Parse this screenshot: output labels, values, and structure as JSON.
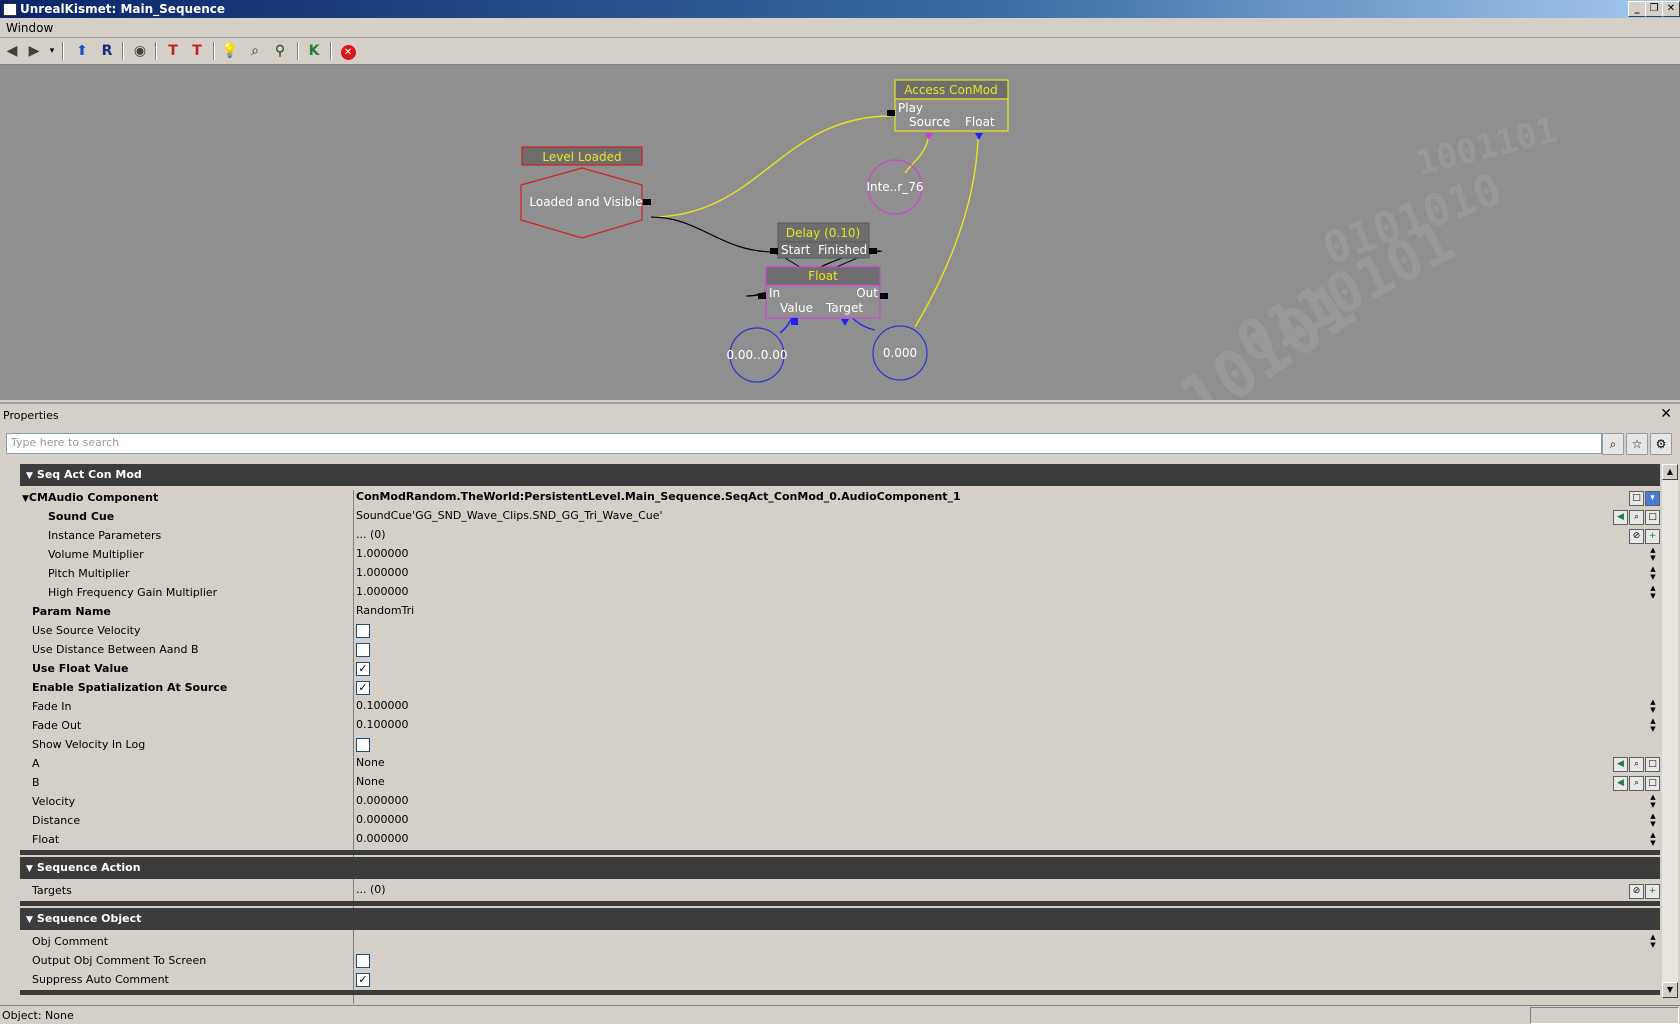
{
  "window": {
    "title": "UnrealKismet: Main_Sequence",
    "min": "_",
    "max": "❐",
    "close": "✕"
  },
  "menu": {
    "window": "Window"
  },
  "toolbar": {
    "icons": [
      "back-arrow-icon",
      "forward-arrow-icon",
      "history-dropdown-icon",
      "parent-sequence-icon",
      "refresh-icon",
      "hide-connectors-icon",
      "toggle-links-icon",
      "toggle-links-alt-icon",
      "bulb-icon",
      "search-icon",
      "binoculars-icon",
      "kismet-k-icon",
      "stop-icon"
    ]
  },
  "graph": {
    "nodes": {
      "level_loaded": {
        "title": "Level Loaded",
        "body": "Loaded and Visible"
      },
      "access_conmod": {
        "title": "Access ConMod",
        "play": "Play",
        "source": "Source",
        "float": "Float"
      },
      "delay": {
        "title": "Delay (0.10)",
        "start": "Start",
        "finished": "Finished"
      },
      "float": {
        "title": "Float",
        "in": "In",
        "out": "Out",
        "value": "Value",
        "target": "Target"
      },
      "var_inte": {
        "label": "Inte..r_76"
      },
      "var_range": {
        "label": "0.00..0.00"
      },
      "var_float": {
        "label": "0.000"
      }
    },
    "colors": {
      "background": "#8f8f8f",
      "event": "#d02020",
      "action": "#e6e620",
      "variable_object": "#d040d0",
      "variable_float": "#3030d0"
    }
  },
  "properties": {
    "panel_title": "Properties",
    "close_label": "✕",
    "search_placeholder": "Type here to search",
    "categories": {
      "seq_act": "Seq Act Con Mod",
      "seq_action": "Sequence Action",
      "seq_object": "Sequence Object"
    },
    "rows": {
      "cm_audio": {
        "name": "CMAudio Component",
        "value": "ConModRandom.TheWorld:PersistentLevel.Main_Sequence.SeqAct_ConMod_0.AudioComponent_1"
      },
      "sound_cue": {
        "name": "Sound Cue",
        "value": "SoundCue'GG_SND_Wave_Clips.SND_GG_Tri_Wave_Cue'"
      },
      "instance_params": {
        "name": "Instance Parameters",
        "value": "... (0)"
      },
      "volume_mult": {
        "name": "Volume Multiplier",
        "value": "1.000000"
      },
      "pitch_mult": {
        "name": "Pitch Multiplier",
        "value": "1.000000"
      },
      "hf_gain": {
        "name": "High Frequency Gain Multiplier",
        "value": "1.000000"
      },
      "param_name": {
        "name": "Param Name",
        "value": "RandomTri"
      },
      "use_source_vel": {
        "name": "Use Source Velocity",
        "checked": false
      },
      "use_dist_ab": {
        "name": "Use Distance Between Aand B",
        "checked": false
      },
      "use_float": {
        "name": "Use Float Value",
        "checked": true
      },
      "enable_spatial": {
        "name": "Enable Spatialization At Source",
        "checked": true
      },
      "fade_in": {
        "name": "Fade In",
        "value": "0.100000"
      },
      "fade_out": {
        "name": "Fade Out",
        "value": "0.100000"
      },
      "show_vel_log": {
        "name": "Show Velocity In Log",
        "checked": false
      },
      "a": {
        "name": "A",
        "value": "None"
      },
      "b": {
        "name": "B",
        "value": "None"
      },
      "velocity": {
        "name": "Velocity",
        "value": "0.000000"
      },
      "distance": {
        "name": "Distance",
        "value": "0.000000"
      },
      "float": {
        "name": "Float",
        "value": "0.000000"
      },
      "targets": {
        "name": "Targets",
        "value": "... (0)"
      },
      "obj_comment": {
        "name": "Obj Comment",
        "value": ""
      },
      "output_comment": {
        "name": "Output Obj Comment To Screen",
        "checked": false
      },
      "suppress_comment": {
        "name": "Suppress Auto Comment",
        "checked": true
      }
    },
    "checkmark": "✓"
  },
  "status": {
    "text": "Object: None"
  }
}
